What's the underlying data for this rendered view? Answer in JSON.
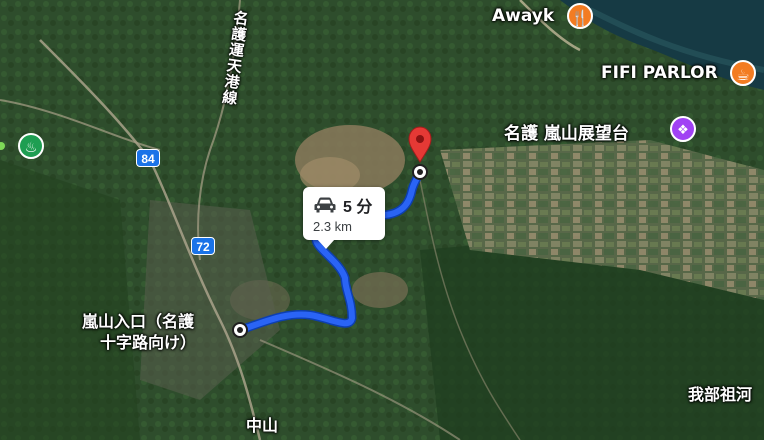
{
  "map": {
    "route_shields": [
      "84",
      "72"
    ],
    "places": {
      "awayk": "Awayk",
      "fifi": "FIFI PARLOR",
      "viewpoint": "名護 嵐山展望台",
      "gabusoka": "我部祖河",
      "nakayama": "中山",
      "road_vertical": "名護運天港線"
    },
    "origin": {
      "line1": "嵐山入口（名護",
      "line2": "十字路向け）"
    },
    "route_info": {
      "duration": "5 分",
      "distance": "2.3 km",
      "mode_icon": "car-icon"
    },
    "icons": {
      "awayk_poi": "restaurant-icon",
      "fifi_poi": "cafe-icon",
      "viewpoint_poi": "viewpoint-icon",
      "onsen_poi": "hot-spring-icon",
      "destination": "red-pin-icon"
    },
    "colors": {
      "route": "#2a64f5",
      "restaurant": "#f37c22",
      "cafe": "#f37c22",
      "viewpoint": "#a142f4",
      "onsen": "#1e9e52",
      "pin": "#e53935"
    }
  }
}
